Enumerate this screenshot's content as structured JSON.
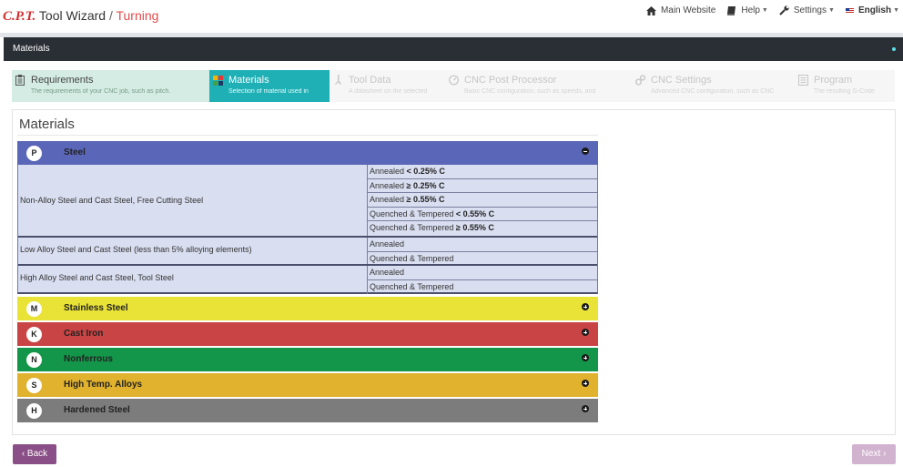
{
  "header": {
    "logo": "C.P.T.",
    "app_title": "Tool Wizard",
    "separator": " / ",
    "mode": "Turning",
    "nav": {
      "main_website": "Main Website",
      "help": "Help",
      "settings": "Settings",
      "language": "English"
    }
  },
  "titlebar": {
    "title": "Materials"
  },
  "steps": [
    {
      "title": "Requirements",
      "subtitle": "The requirements of your CNC job, such as pitch.",
      "state": "done"
    },
    {
      "title": "Materials",
      "subtitle": "Selection of material used in",
      "state": "active"
    },
    {
      "title": "Tool Data",
      "subtitle": "A datasheet on the selected",
      "state": "future"
    },
    {
      "title": "CNC Post Processor",
      "subtitle": "Basic CNC configuration, such as speeds, and",
      "state": "future"
    },
    {
      "title": "CNC Settings",
      "subtitle": "Advanced CNC configuration, such as CNC",
      "state": "future"
    },
    {
      "title": "Program",
      "subtitle": "The resulting G-Code",
      "state": "future"
    }
  ],
  "panel": {
    "title": "Materials"
  },
  "categories": [
    {
      "letter": "P",
      "name": "Steel",
      "color": "#5a67b8",
      "expanded": true
    },
    {
      "letter": "M",
      "name": "Stainless Steel",
      "color": "#e9e338",
      "expanded": false
    },
    {
      "letter": "K",
      "name": "Cast Iron",
      "color": "#c94444",
      "expanded": false
    },
    {
      "letter": "N",
      "name": "Nonferrous",
      "color": "#139649",
      "expanded": false
    },
    {
      "letter": "S",
      "name": "High Temp. Alloys",
      "color": "#e0b22e",
      "expanded": false
    },
    {
      "letter": "H",
      "name": "Hardened Steel",
      "color": "#7c7c7c",
      "expanded": false
    }
  ],
  "steel_groups": [
    {
      "name": "Non-Alloy Steel and Cast Steel, Free Cutting Steel",
      "options": [
        {
          "text": "Annealed ",
          "bold": "< 0.25% C"
        },
        {
          "text": "Annealed ",
          "bold": "≥ 0.25% C"
        },
        {
          "text": "Annealed ",
          "bold": "≥ 0.55% C"
        },
        {
          "text": "Quenched & Tempered ",
          "bold": "< 0.55% C"
        },
        {
          "text": "Quenched & Tempered ",
          "bold": "≥ 0.55% C"
        }
      ]
    },
    {
      "name": "Low Alloy Steel and Cast Steel (less than 5% alloying elements)",
      "options": [
        {
          "text": "Annealed",
          "bold": ""
        },
        {
          "text": "Quenched & Tempered",
          "bold": ""
        }
      ]
    },
    {
      "name": "High Alloy Steel and Cast Steel, Tool Steel",
      "options": [
        {
          "text": "Annealed",
          "bold": ""
        },
        {
          "text": "Quenched & Tempered",
          "bold": ""
        }
      ]
    }
  ],
  "buttons": {
    "back": "‹ Back",
    "next": "Next ›"
  }
}
